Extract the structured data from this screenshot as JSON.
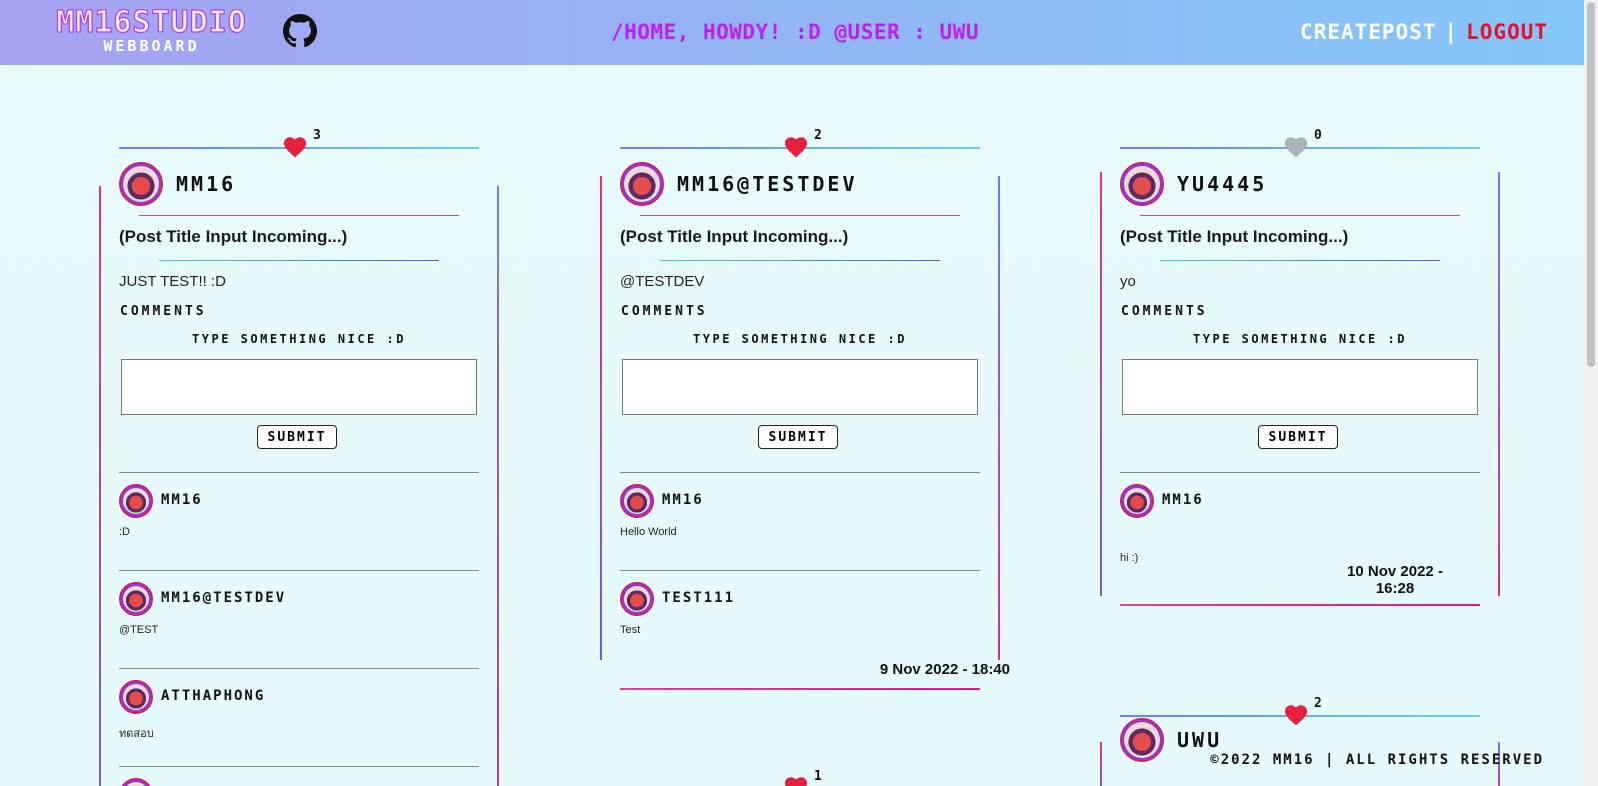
{
  "header": {
    "logo_title": "MM16STUDIO",
    "logo_sub": "WEBBOARD",
    "greeting": "/HOME, HOWDY! :D @USER : UWU",
    "create_post": "CREATEPOST",
    "separator": "|",
    "logout": "LOGOUT"
  },
  "posts": [
    {
      "likes": "3",
      "liked": true,
      "username": "MM16",
      "title": "(Post Title Input Incoming...)",
      "body": "JUST TEST!! :D",
      "comments_label": "COMMENTS",
      "prompt": "TYPE SOMETHING NICE :D",
      "submit": "SUBMIT",
      "comments": [
        {
          "name": "MM16",
          "text": ":D"
        },
        {
          "name": "MM16@TESTDEV",
          "text": "@TEST"
        },
        {
          "name": "ATTHAPHONG",
          "text": "ทดสอบ"
        }
      ]
    },
    {
      "likes": "2",
      "liked": true,
      "username": "MM16@TESTDEV",
      "title": "(Post Title Input Incoming...)",
      "body": "@TESTDEV",
      "comments_label": "COMMENTS",
      "prompt": "TYPE SOMETHING NICE :D",
      "submit": "SUBMIT",
      "comments": [
        {
          "name": "MM16",
          "text": "Hello World"
        },
        {
          "name": "TEST111",
          "text": "Test"
        }
      ],
      "date": "9 Nov 2022 - 18:40"
    },
    {
      "likes": "0",
      "liked": false,
      "username": "YU4445",
      "title": "(Post Title Input Incoming...)",
      "body": "yo",
      "comments_label": "COMMENTS",
      "prompt": "TYPE SOMETHING NICE :D",
      "submit": "SUBMIT",
      "comments": [
        {
          "name": "MM16",
          "text": "hi :)"
        }
      ],
      "date": "10 Nov 2022 - 16:28"
    },
    {
      "likes": "2",
      "liked": true,
      "username": "UWU"
    },
    {
      "likes": "1",
      "liked": true
    }
  ],
  "footer": "©2022 MM16 | ALL RIGHTS RESERVED",
  "colors": {
    "heart_liked": "#e8203f",
    "heart_unliked": "#aab2bb",
    "greeting": "#c11cf0",
    "logout": "#e8102a"
  }
}
